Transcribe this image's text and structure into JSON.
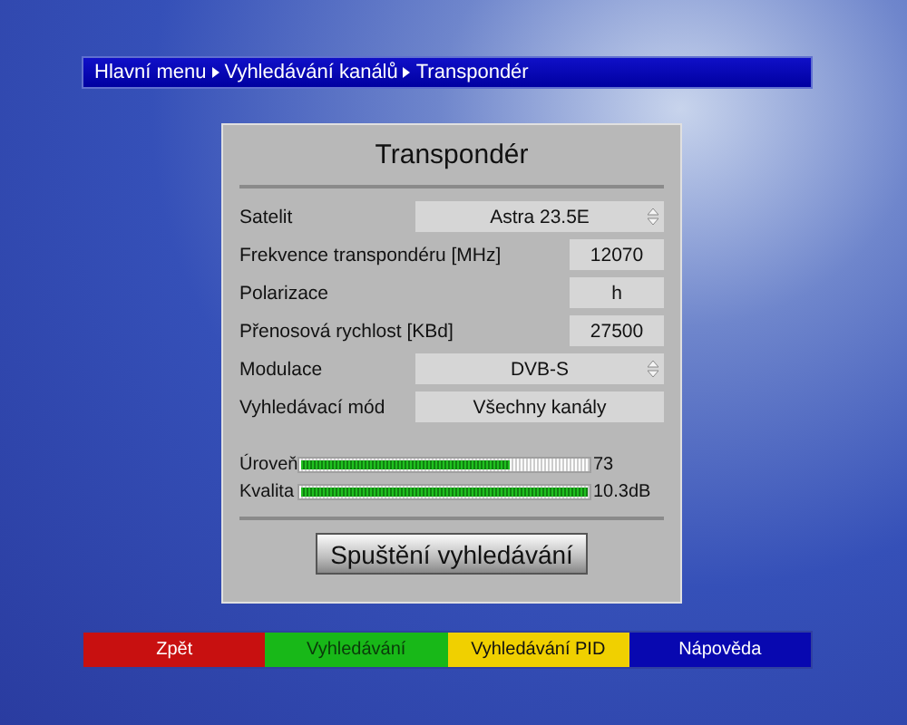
{
  "breadcrumb": [
    "Hlavní menu",
    "Vyhledávání kanálů",
    "Transpondér"
  ],
  "dialog": {
    "title": "Transpondér",
    "fields": [
      {
        "label": "Satelit",
        "value": "Astra 23.5E",
        "kind": "select"
      },
      {
        "label": "Frekvence transpondéru [MHz]",
        "value": "12070",
        "kind": "number"
      },
      {
        "label": "Polarizace",
        "value": "h",
        "kind": "number"
      },
      {
        "label": "Přenosová rychlost [KBd]",
        "value": "27500",
        "kind": "number"
      },
      {
        "label": "Modulace",
        "value": "DVB-S",
        "kind": "select"
      },
      {
        "label": "Vyhledávací mód",
        "value": "Všechny kanály",
        "kind": "text"
      }
    ],
    "meters": [
      {
        "label": "Úroveň",
        "level": 0.73,
        "reading": "73"
      },
      {
        "label": "Kvalita",
        "level": 1.0,
        "reading": "10.3dB"
      }
    ],
    "button": "Spuštění vyhledávání"
  },
  "color_buttons": [
    {
      "label": "Zpět",
      "color": "#c81010"
    },
    {
      "label": "Vyhledávání",
      "color": "#18b818"
    },
    {
      "label": "Vyhledávání PID",
      "color": "#f0d000"
    },
    {
      "label": "Nápověda",
      "color": "#0808b0"
    }
  ]
}
